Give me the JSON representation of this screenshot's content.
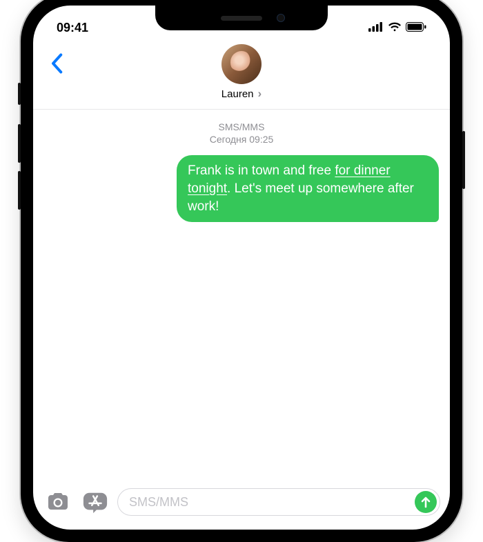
{
  "status": {
    "time": "09:41"
  },
  "header": {
    "contact_name": "Lauren"
  },
  "conversation": {
    "channel_label": "SMS/MMS",
    "timestamp": "Сегодня 09:25",
    "messages": [
      {
        "text_before": "Frank is in town and free ",
        "underlined": "for dinner tonight",
        "text_after": ". Let's meet up somewhere after work!"
      }
    ]
  },
  "compose": {
    "placeholder": "SMS/MMS"
  }
}
